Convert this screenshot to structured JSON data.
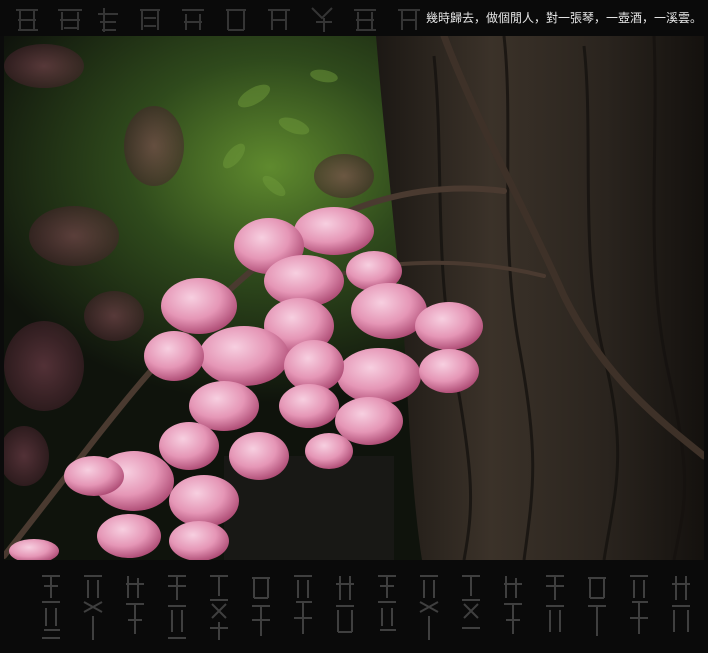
{
  "caption": "幾時歸去，做個閒人，對一張琴，一壺酒，一溪雲。",
  "colors": {
    "frame": "#0b0b0b",
    "blossom": "#e8a4bd",
    "blossom_shadow": "#b5527a",
    "bark": "#3a3128",
    "foliage": "#2c4a1e"
  },
  "photo": {
    "subject": "pink-wisteria-blossoms",
    "background": "tree-trunk-and-foliage"
  },
  "decoration": {
    "top_calligraphy": "",
    "bottom_calligraphy": ""
  }
}
